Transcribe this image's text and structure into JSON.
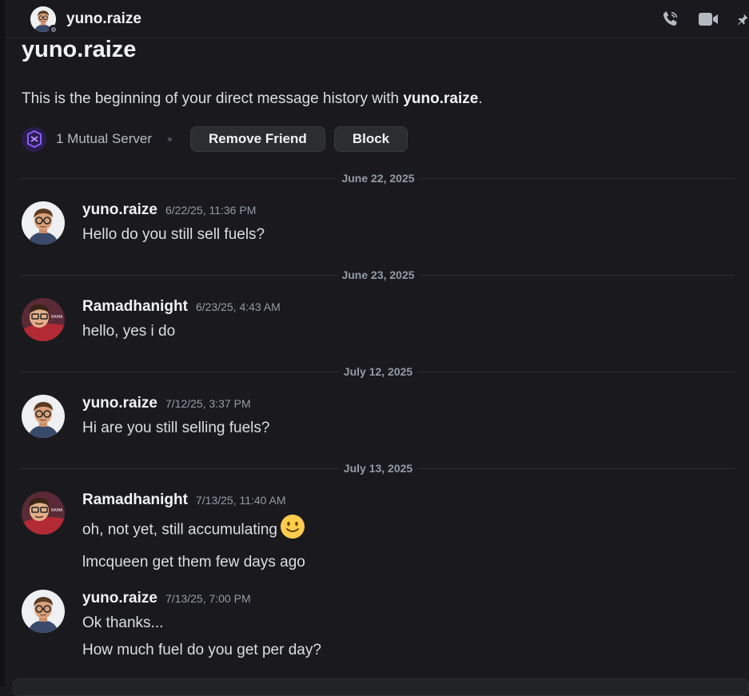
{
  "header": {
    "title": "yuno.raize",
    "icons": [
      "phone-call-icon",
      "video-call-icon",
      "pin-icon"
    ]
  },
  "intro": {
    "name": "yuno.raize",
    "text_prefix": "This is the beginning of your direct message history with ",
    "text_user": "yuno.raize",
    "text_suffix": ".",
    "mutual_server": "1 Mutual Server",
    "remove_friend": "Remove Friend",
    "block": "Block"
  },
  "messages": [
    {
      "date": "June 22, 2025",
      "author": "yuno.raize",
      "time": "6/22/25, 11:36 PM",
      "lines": [
        "Hello do you still sell fuels?"
      ]
    },
    {
      "date": "June 23, 2025",
      "author": "Ramadhanight",
      "time": "6/23/25, 4:43 AM",
      "lines": [
        "hello, yes i do"
      ]
    },
    {
      "date": "July 12, 2025",
      "author": "yuno.raize",
      "time": "7/12/25, 3:37 PM",
      "lines": [
        "Hi are you still selling fuels?"
      ]
    },
    {
      "date": "July 13, 2025",
      "author": "Ramadhanight",
      "time": "7/13/25, 11:40 AM",
      "lines": [
        "oh, not yet, still accumulating",
        "lmcqueen get them few days ago"
      ],
      "emoji": "slightly-smiling-face"
    },
    {
      "author": "yuno.raize",
      "time": "7/13/25, 7:00 PM",
      "lines": [
        "Ok thanks...",
        "How much fuel do you get per day?"
      ]
    }
  ],
  "colors": {
    "background": "#1a1a1e",
    "text": "#dbdee1",
    "muted": "#949ba4",
    "button": "#2b2d31"
  }
}
